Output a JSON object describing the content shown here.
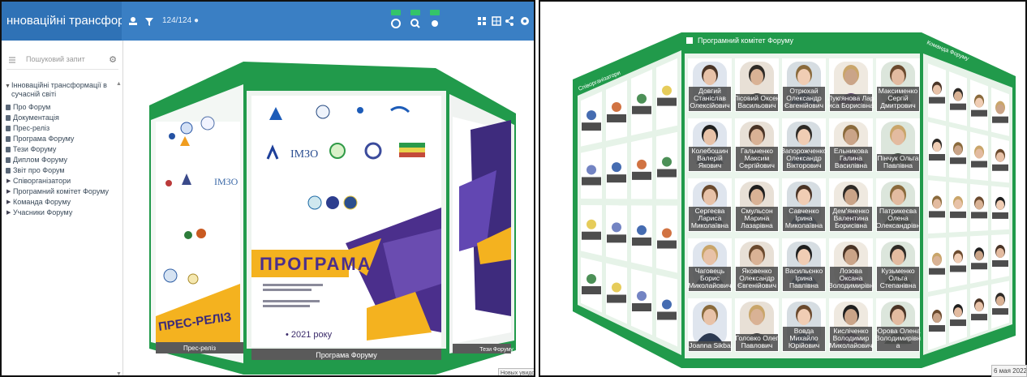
{
  "app": {
    "title": "нноваційні трансформації...",
    "counter": "124/124"
  },
  "sidebar": {
    "search_placeholder": "Пошуковий запит",
    "root_label": "Інноваційні трансформації в сучасній світі",
    "items": [
      {
        "label": "Про Форум",
        "type": "doc"
      },
      {
        "label": "Документація",
        "type": "doc"
      },
      {
        "label": "Прес-реліз",
        "type": "doc"
      },
      {
        "label": "Програма Форуму",
        "type": "doc"
      },
      {
        "label": "Тези Форуму",
        "type": "doc"
      },
      {
        "label": "Диплом Форуму",
        "type": "doc"
      },
      {
        "label": "Звіт про Форум",
        "type": "doc"
      },
      {
        "label": "Співорганізатори",
        "type": "folder"
      },
      {
        "label": "Програмний комітет Форуму",
        "type": "folder"
      },
      {
        "label": "Команда Форуму",
        "type": "folder"
      },
      {
        "label": "Учасники Форуму",
        "type": "folder"
      }
    ]
  },
  "left_gallery": {
    "top_label": "Програма Форуму",
    "bottom_label": "Програма Форуму",
    "programa_word": "ПРОГРАМА",
    "year_text": "• 2021 року",
    "press_release": "ПРЕС-РЕЛІЗ",
    "left_bottom_label": "Прес-реліз",
    "right_bottom_label": "Тези Форуму",
    "imzo_text": "ІМЗО",
    "caption": "Новых увидомл"
  },
  "right_gallery": {
    "title": "Програмний комітет Форуму",
    "left_wing_label": "Співорганізатори",
    "right_wing_label": "Команда Форуму",
    "caption": "6 мая 2022 г.",
    "people": [
      {
        "name": [
          "Довгий",
          "Станіслав",
          "Олексійович"
        ]
      },
      {
        "name": [
          "Лісовий Оксен",
          "Васильович"
        ]
      },
      {
        "name": [
          "Отрюхай",
          "Олександр",
          "Євгенійович"
        ]
      },
      {
        "name": [
          "Лукгянова Лар",
          "иса Борисівна"
        ]
      },
      {
        "name": [
          "Максименко",
          "Сергій",
          "Дмитрович"
        ]
      },
      {
        "name": [
          "Колебошин",
          "Валерій",
          "Якович"
        ]
      },
      {
        "name": [
          "Гальченко",
          "Максим",
          "Сергійович"
        ]
      },
      {
        "name": [
          "Запорожченко",
          "Олександр",
          "Вікторович"
        ]
      },
      {
        "name": [
          "Ельникова",
          "Галина",
          "Василівна"
        ]
      },
      {
        "name": [
          "Пінчук Ольга",
          "Павлівна"
        ]
      },
      {
        "name": [
          "Сергеєва",
          "Лариса",
          "Миколаївна"
        ]
      },
      {
        "name": [
          "Смульсон",
          "Марина",
          "Лазарівна"
        ]
      },
      {
        "name": [
          "Савченко",
          "Ірина",
          "Миколаївна"
        ]
      },
      {
        "name": [
          "Дем'яненко",
          "Валентина",
          "Борисівна"
        ]
      },
      {
        "name": [
          "Патрикеєва",
          "Олена",
          "Олександрівн"
        ]
      },
      {
        "name": [
          "Чаговець",
          "Борис",
          "Миколайович"
        ]
      },
      {
        "name": [
          "Яковенко",
          "Олександр",
          "Євгенійович"
        ]
      },
      {
        "name": [
          "Васильєнко",
          "Ірина",
          "Павлівна"
        ]
      },
      {
        "name": [
          "Лозова",
          "Оксана",
          "Володимирівн"
        ]
      },
      {
        "name": [
          "Кузьменко",
          "Ольга",
          "Степанівна"
        ]
      },
      {
        "name": [
          "Joanna Sikba"
        ]
      },
      {
        "name": [
          "Головко Олег",
          "Павлович"
        ]
      },
      {
        "name": [
          "Вовда",
          "Михайло",
          "Юрійович"
        ]
      },
      {
        "name": [
          "Кисліченко",
          "Володимир",
          "Миколайович"
        ]
      },
      {
        "name": [
          "Юрова Олена",
          "Володимирівн",
          "а"
        ]
      }
    ]
  },
  "colors": {
    "topbar": "#3a7fc4",
    "gallery_green": "#219a4b",
    "accent_yellow": "#f4b21f",
    "accent_purple": "#4b2f8c"
  }
}
